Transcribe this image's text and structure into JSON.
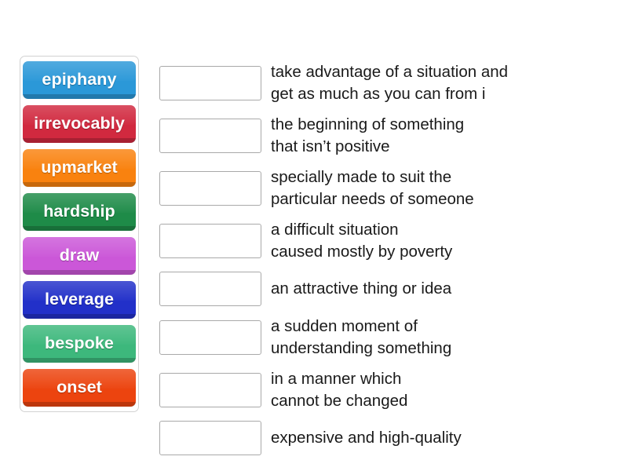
{
  "activity": {
    "type": "match-up",
    "tile_panel": {
      "name": "word-tiles",
      "tiles": [
        {
          "label": "epiphany",
          "color": "#2b98d8"
        },
        {
          "label": "irrevocably",
          "color": "#d1293f"
        },
        {
          "label": "upmarket",
          "color": "#f9820f"
        },
        {
          "label": "hardship",
          "color": "#1e8b48"
        },
        {
          "label": "draw",
          "color": "#cb57d8"
        },
        {
          "label": "leverage",
          "color": "#2230c9"
        },
        {
          "label": "bespoke",
          "color": "#3db87c"
        },
        {
          "label": "onset",
          "color": "#ec440f"
        }
      ]
    },
    "rows": [
      {
        "answer": "",
        "definition": "take advantage of a situation and\nget as much as you can from i"
      },
      {
        "answer": "",
        "definition": "the beginning of something\nthat isn’t positive"
      },
      {
        "answer": "",
        "definition": "specially made to suit the\nparticular needs of someone"
      },
      {
        "answer": "",
        "definition": "a difficult situation\ncaused mostly by poverty"
      },
      {
        "answer": "",
        "definition": "an attractive thing or idea"
      },
      {
        "answer": "",
        "definition": "a sudden moment of\nunderstanding something"
      },
      {
        "answer": "",
        "definition": "in a manner which\ncannot be changed"
      },
      {
        "answer": "",
        "definition": "expensive and high-quality"
      }
    ],
    "dropzone_placeholder": ""
  }
}
